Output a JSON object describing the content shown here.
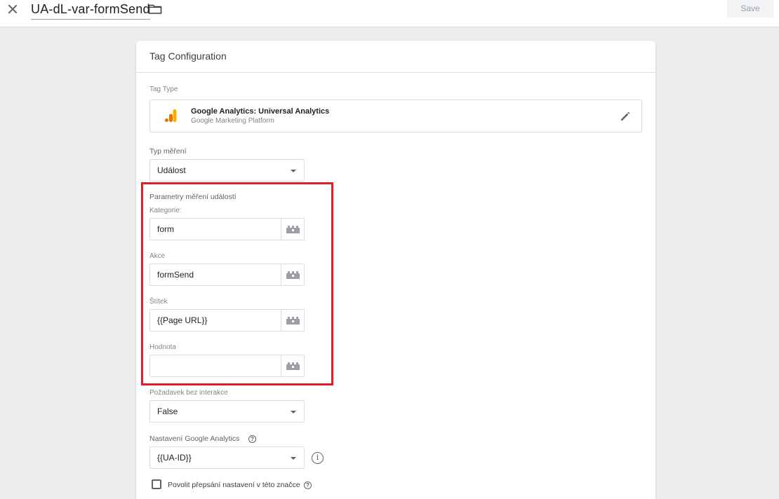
{
  "topbar": {
    "tag_name": "UA-dL-var-formSend",
    "save_label": "Save"
  },
  "card": {
    "title": "Tag Configuration",
    "tag_type_label": "Tag Type",
    "tag_type": {
      "name": "Google Analytics: Universal Analytics",
      "provider": "Google Marketing Platform",
      "logo_colors": [
        "#f9ab00",
        "#e37400"
      ]
    },
    "track_type": {
      "label": "Typ měření",
      "value": "Událost"
    },
    "event_params": {
      "heading": "Parametry měření událostí",
      "fields": [
        {
          "label": "Kategorie:",
          "value": "form"
        },
        {
          "label": "Akce",
          "value": "formSend"
        },
        {
          "label": "Štítek",
          "value": "{{Page URL}}"
        },
        {
          "label": "Hodnota",
          "value": ""
        }
      ]
    },
    "non_interaction": {
      "label": "Požadavek bez interakce",
      "value": "False"
    },
    "ga_settings": {
      "label": "Nastavení Google Analytics",
      "value": "{{UA-ID}}",
      "help_icon": "?",
      "info_icon": "i"
    },
    "override": {
      "label": "Povolit přepsání nastavení v této značce",
      "checked": false,
      "help_icon": "?"
    }
  },
  "highlight_color": "#e31e24"
}
